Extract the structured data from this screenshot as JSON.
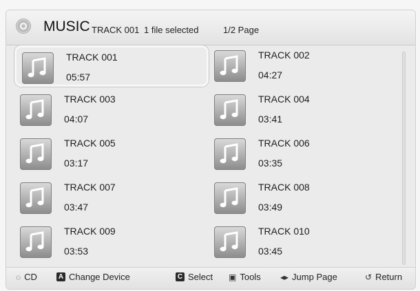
{
  "header": {
    "title": "MUSIC",
    "track": "TRACK 001",
    "selection": "1 file selected",
    "page": "1/2 Page"
  },
  "tracks": [
    {
      "name": "TRACK 001",
      "time": "05:57"
    },
    {
      "name": "TRACK 002",
      "time": "04:27"
    },
    {
      "name": "TRACK 003",
      "time": "04:07"
    },
    {
      "name": "TRACK 004",
      "time": "03:41"
    },
    {
      "name": "TRACK 005",
      "time": "03:17"
    },
    {
      "name": "TRACK 006",
      "time": "03:35"
    },
    {
      "name": "TRACK 007",
      "time": "03:47"
    },
    {
      "name": "TRACK 008",
      "time": "03:49"
    },
    {
      "name": "TRACK 009",
      "time": "03:53"
    },
    {
      "name": "TRACK 010",
      "time": "03:45"
    }
  ],
  "footer": {
    "cd": "CD",
    "change_key": "A",
    "change_device": "Change Device",
    "select_key": "C",
    "select": "Select",
    "tools": "Tools",
    "jump_page": "Jump Page",
    "return": "Return"
  },
  "icons": {
    "header": "disc-icon",
    "track": "music-note-icon",
    "footer_tools": "tools-icon",
    "footer_jump": "left-right-arrows-icon",
    "footer_return": "return-arrow-icon"
  }
}
